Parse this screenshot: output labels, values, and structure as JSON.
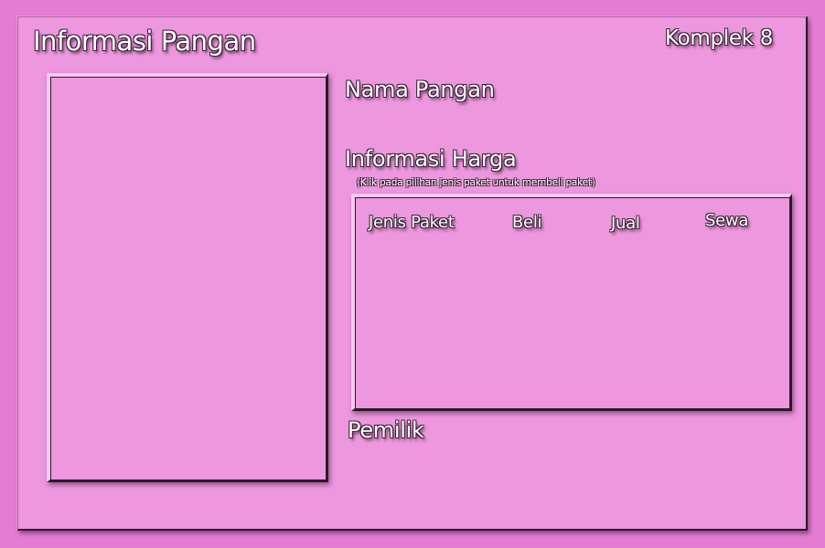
{
  "header": {
    "title": "Informasi Pangan",
    "complex": "Komplek 8"
  },
  "details": {
    "name_label": "Nama Pangan",
    "price_label": "Informasi Harga",
    "price_hint": "(Klik pada pilihan jenis paket untuk membeli paket)",
    "owner_label": "Pemilik"
  },
  "price_table": {
    "columns": [
      "Jenis Paket",
      "Beli",
      "Jual",
      "Sewa"
    ],
    "rows": []
  },
  "colors": {
    "background": "#ed97de",
    "outer": "#e47cd3",
    "text": "#ffffff",
    "outline": "#3a2036"
  }
}
